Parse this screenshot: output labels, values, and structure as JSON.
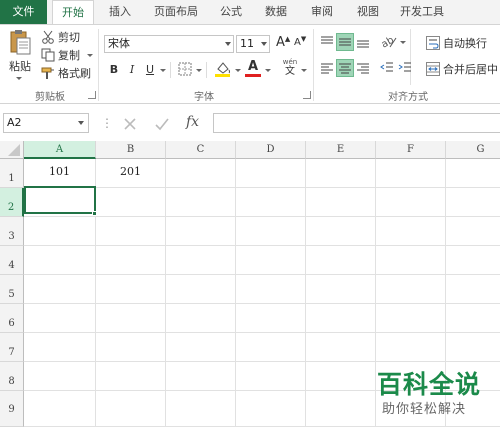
{
  "tabs": {
    "file": "文件",
    "home": "开始",
    "insert": "插入",
    "page_layout": "页面布局",
    "formulas": "公式",
    "data": "数据",
    "review": "审阅",
    "view": "视图",
    "developer": "开发工具"
  },
  "clipboard": {
    "paste": "粘贴",
    "cut": "剪切",
    "copy": "复制",
    "format_painter": "格式刷",
    "group_label": "剪贴板"
  },
  "font": {
    "name": "宋体",
    "size": "11",
    "bold": "B",
    "italic": "I",
    "underline": "U",
    "grow": "A",
    "shrink": "A",
    "phonetic_top": "wén",
    "phonetic_bottom": "文",
    "font_color_glyph": "A",
    "group_label": "字体"
  },
  "alignment": {
    "wrap_text": "自动换行",
    "merge_center": "合并后居中",
    "group_label": "对齐方式"
  },
  "formula_bar": {
    "name_box": "A2",
    "fx": "fx",
    "value": ""
  },
  "grid": {
    "columns": [
      "A",
      "B",
      "C",
      "D",
      "E",
      "F",
      "G"
    ],
    "rows": [
      "1",
      "2",
      "3",
      "4",
      "5",
      "6",
      "7",
      "8",
      "9"
    ],
    "cells": {
      "A1": "101",
      "B1": "201"
    },
    "active_cell": "A2"
  },
  "watermark": {
    "title": "百科全说",
    "subtitle": "助你轻松解决"
  },
  "colors": {
    "accent": "#217346",
    "selected_header": "#d3f0e0",
    "font_color_bar": "#e02020",
    "fill_color_bar": "#ffe000"
  }
}
